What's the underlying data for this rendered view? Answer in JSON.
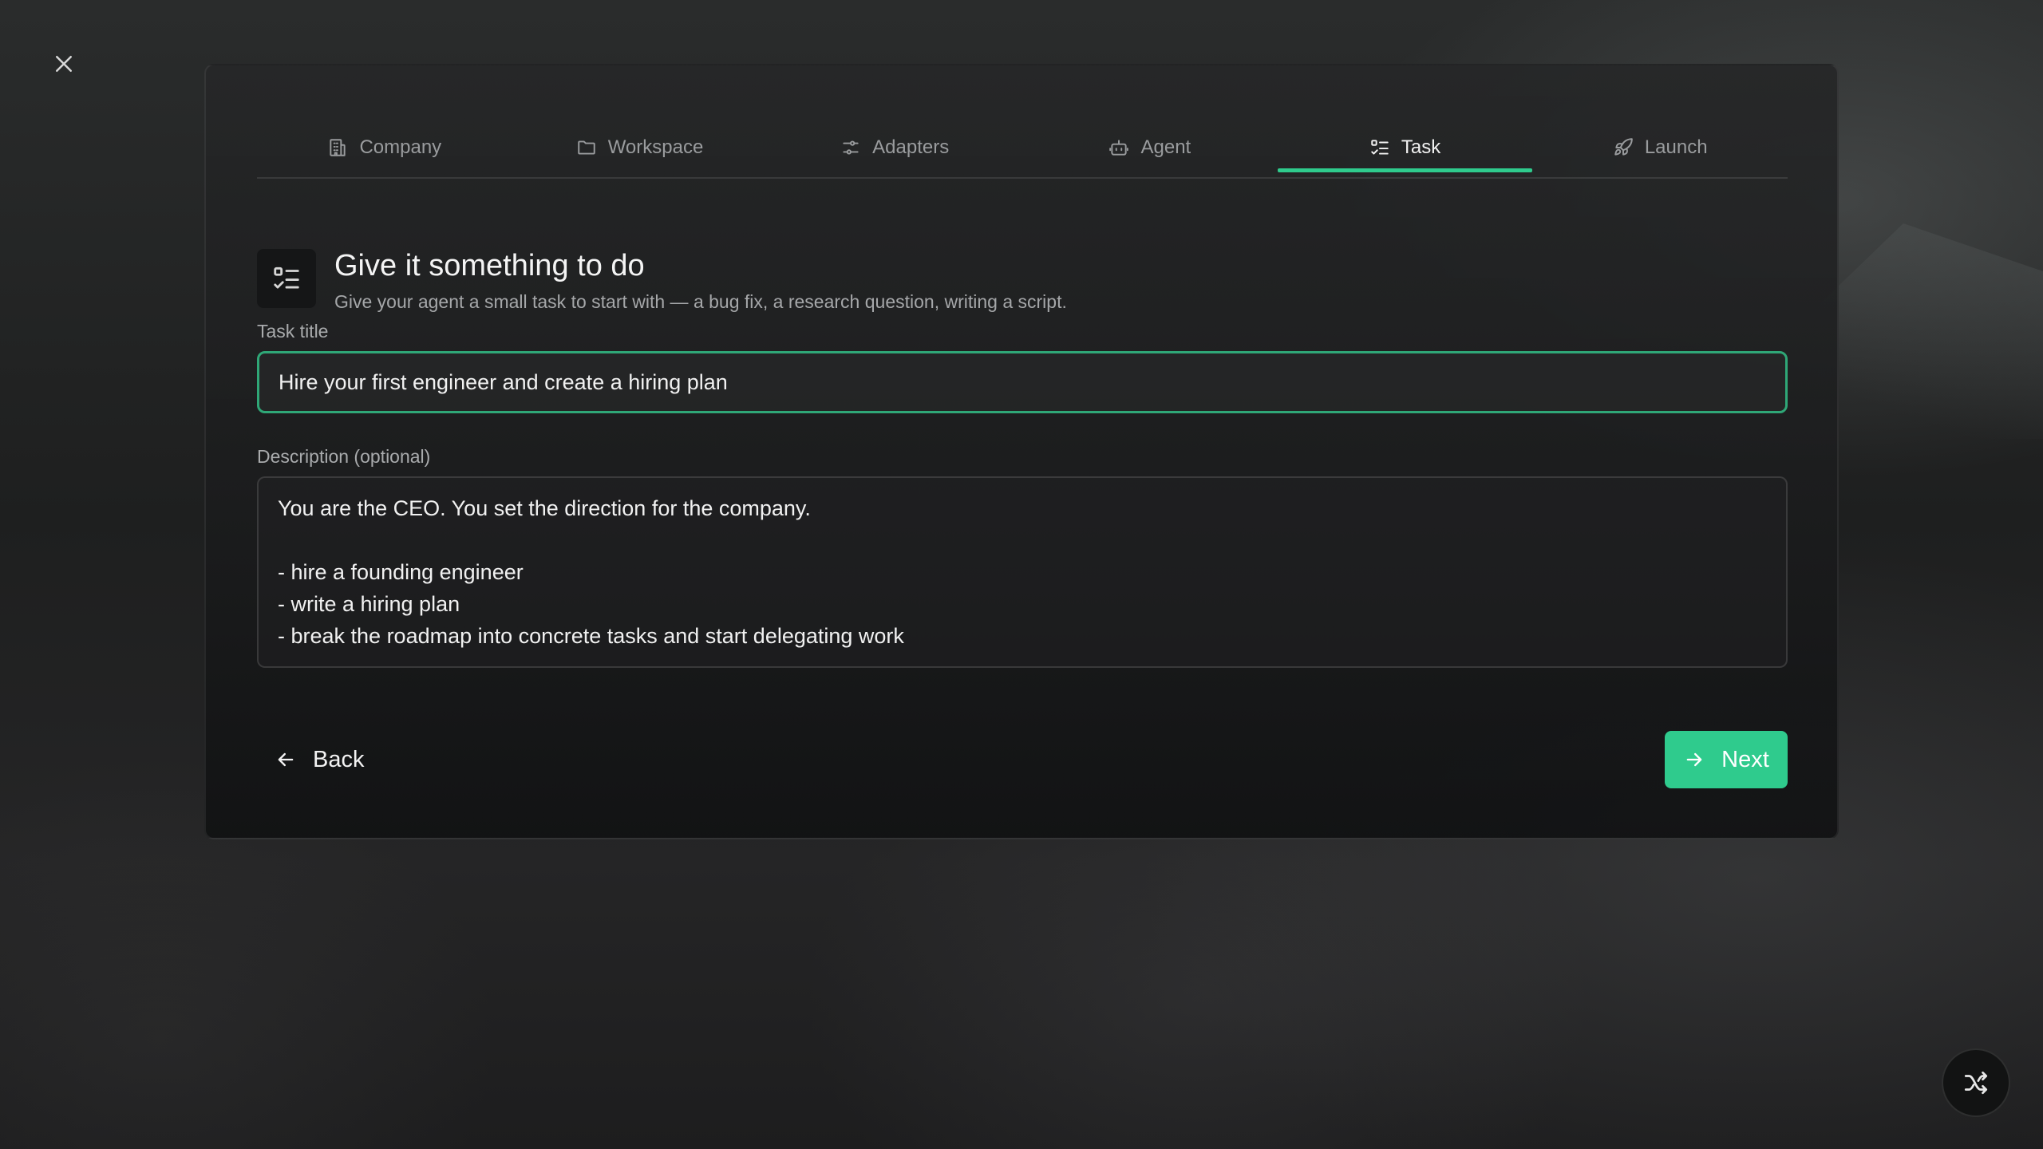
{
  "colors": {
    "accent": "#2fcb8d",
    "background": "#1c1d1d",
    "card": "#262728"
  },
  "close": {
    "icon": "close-icon"
  },
  "tabs": [
    {
      "label": "Company",
      "icon": "building-icon",
      "active": false
    },
    {
      "label": "Workspace",
      "icon": "folder-icon",
      "active": false
    },
    {
      "label": "Adapters",
      "icon": "sliders-icon",
      "active": false
    },
    {
      "label": "Agent",
      "icon": "bot-icon",
      "active": false
    },
    {
      "label": "Task",
      "icon": "list-checks-icon",
      "active": true
    },
    {
      "label": "Launch",
      "icon": "rocket-icon",
      "active": false
    }
  ],
  "header": {
    "icon": "list-checks-icon",
    "title": "Give it something to do",
    "subtitle": "Give your agent a small task to start with — a bug fix, a research question, writing a script."
  },
  "form": {
    "task_title_label": "Task title",
    "task_title_value": "Hire your first engineer and create a hiring plan",
    "description_label": "Description (optional)",
    "description_lines": [
      "You are the CEO. You set the direction for the company.",
      "",
      "- hire a founding engineer",
      "- write a hiring plan",
      "- break the roadmap into concrete tasks and start delegating work"
    ]
  },
  "actions": {
    "back_label": "Back",
    "next_label": "Next"
  },
  "shuffle": {
    "icon": "shuffle-icon"
  }
}
